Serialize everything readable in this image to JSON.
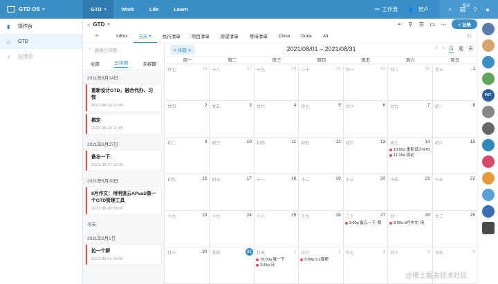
{
  "topbar": {
    "app_name": "GTD OS",
    "nav": [
      "GTD",
      "Work",
      "Life",
      "Learn"
    ],
    "workbench": "工作流",
    "users": "用户",
    "badge_count": "15"
  },
  "sidebar": {
    "items": [
      {
        "label": "操作台",
        "icon": "bookmark-icon"
      },
      {
        "label": "GTD",
        "icon": "cup-icon"
      },
      {
        "label": "应用场",
        "icon": "plus-icon"
      }
    ]
  },
  "main": {
    "title": "GTD",
    "add_button": "+ 记录",
    "tabs": [
      "InBox",
      "日历",
      "执行清单",
      "项目清单",
      "愿望清单",
      "等待清单",
      "Close",
      "Done",
      "All"
    ]
  },
  "listpanel": {
    "search_placeholder": "搜索已排期",
    "filters": [
      "全部",
      "已排期",
      "未排期"
    ],
    "groups": [
      {
        "date": "2021年8月14日",
        "cards": [
          {
            "title": "重新设计GTD，融合代办、习惯",
            "time": "2021-08-14 10:00"
          },
          {
            "title": "搞定",
            "time": "2021-08-14 11:15"
          }
        ]
      },
      {
        "date": "2021年8月27日",
        "cards": [
          {
            "title": "备忘一下:",
            "time": "2021-08-27 15:00"
          }
        ]
      },
      {
        "date": "2021年8月28日",
        "cards": [
          {
            "title": "8月作文：用明道云APaaS做一个GTD管理工具",
            "time": "2021-08-28 08:00"
          }
        ]
      },
      {
        "date": "今天",
        "cards": []
      },
      {
        "date": "2021年9月1日",
        "cards": [
          {
            "title": "拉一个群",
            "time": "2021-09-01 10:00"
          }
        ]
      }
    ]
  },
  "calendar": {
    "chip": "排期",
    "range": "2021/08/01 – 2021/08/31",
    "views": [
      "月",
      "周",
      "天"
    ],
    "weekdays": [
      "周一",
      "周二",
      "周三",
      "周四",
      "周五",
      "周六",
      "周日"
    ],
    "weeks": [
      [
        {
          "l": "廿七",
          "d": "26",
          "o": true
        },
        {
          "l": "十八",
          "d": "27",
          "o": true
        },
        {
          "l": "十九",
          "d": "28",
          "o": true
        },
        {
          "l": "二十",
          "d": "29",
          "o": true
        },
        {
          "l": "廿一",
          "d": "30",
          "o": true
        },
        {
          "l": "廿二",
          "d": "31",
          "o": true
        },
        {
          "l": "廿三",
          "d": "1"
        }
      ],
      [
        {
          "l": "廿四",
          "d": "2"
        },
        {
          "l": "廿五",
          "d": "3"
        },
        {
          "l": "廿六",
          "d": "4"
        },
        {
          "l": "廿七",
          "d": "5"
        },
        {
          "l": "廿八",
          "d": "6"
        },
        {
          "l": "廿九",
          "d": "7"
        },
        {
          "l": "初一",
          "d": "8"
        }
      ],
      [
        {
          "l": "初二",
          "d": "9"
        },
        {
          "l": "初三",
          "d": "10"
        },
        {
          "l": "初四",
          "d": "11"
        },
        {
          "l": "初五",
          "d": "12"
        },
        {
          "l": "初六",
          "d": "13"
        },
        {
          "l": "初七",
          "d": "14",
          "ev": [
            "10:00a 重新设计GTD",
            "11:15a 搞定"
          ]
        },
        {
          "l": "初八",
          "d": "15"
        }
      ],
      [
        {
          "l": "初九",
          "d": "16"
        },
        {
          "l": "初十",
          "d": "17"
        },
        {
          "l": "十一",
          "d": "18"
        },
        {
          "l": "十二",
          "d": "19"
        },
        {
          "l": "十三",
          "d": "20"
        },
        {
          "l": "十四",
          "d": "21"
        },
        {
          "l": "十五",
          "d": "22"
        }
      ],
      [
        {
          "l": "十六",
          "d": "23"
        },
        {
          "l": "十七",
          "d": "24"
        },
        {
          "l": "十八",
          "d": "25"
        },
        {
          "l": "十九",
          "d": "26"
        },
        {
          "l": "二十",
          "d": "27",
          "ev": [
            "3:00p 备忘一下: 我"
          ]
        },
        {
          "l": "廿一",
          "d": "28",
          "ev": [
            "8:00a 8月作文: 用"
          ]
        },
        {
          "l": "廿二",
          "d": "29"
        }
      ],
      [
        {
          "l": "廿三",
          "d": "30"
        },
        {
          "l": "廿四",
          "d": "31",
          "t": true
        },
        {
          "l": "廿五",
          "d": "1",
          "o": true,
          "ev": [
            "10:00a 我一下",
            "2:34p 马"
          ]
        },
        {
          "l": "廿六",
          "d": "2",
          "o": true,
          "ev": [
            "8:00p 9.2喜筋"
          ]
        },
        {
          "l": "廿七",
          "d": "3",
          "o": true
        },
        {
          "l": "廿八",
          "d": "4",
          "o": true
        },
        {
          "l": "廿九",
          "d": "5",
          "o": true
        }
      ]
    ]
  },
  "watermark": "@稀土掘金技术社区",
  "colors": {
    "primary": "#3a8fc8",
    "event": "#e0524a"
  }
}
